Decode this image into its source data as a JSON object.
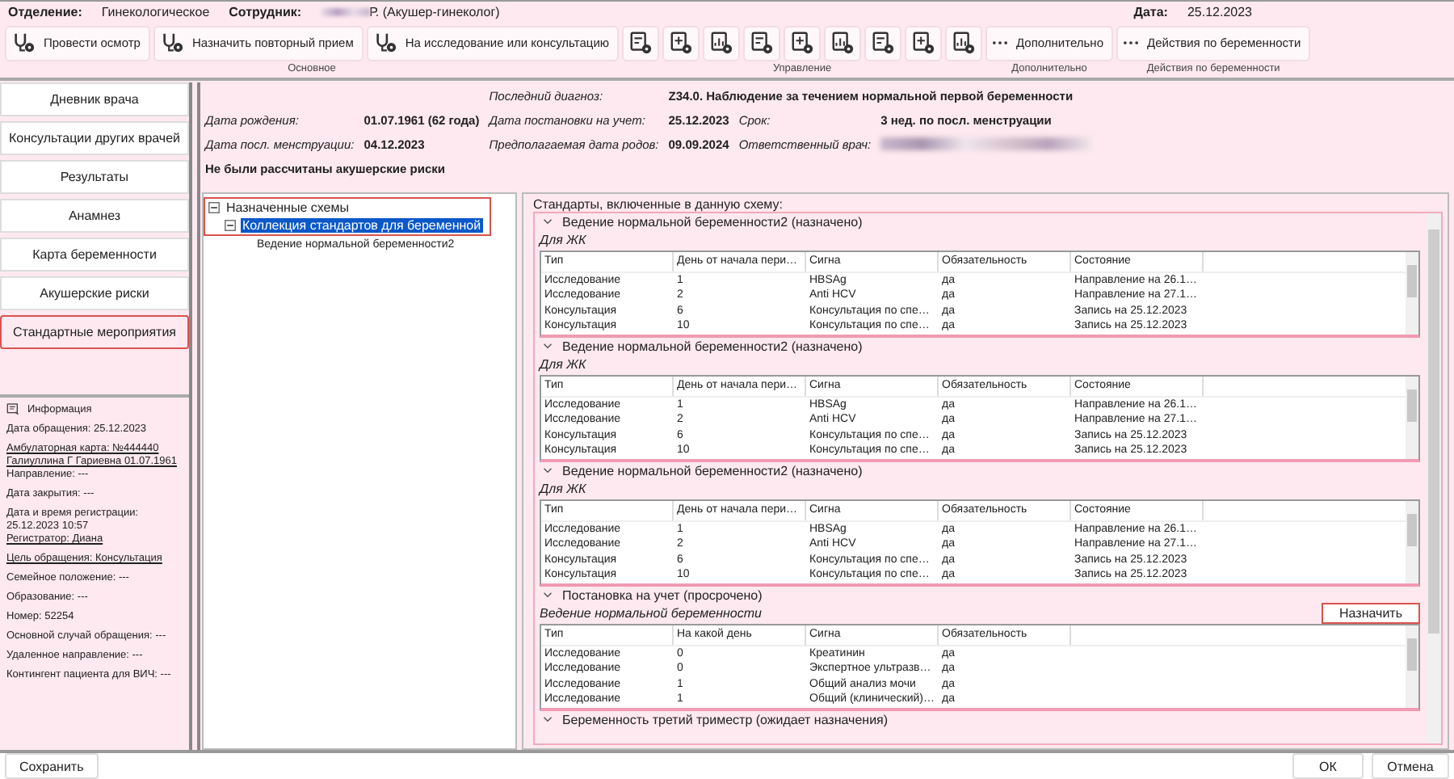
{
  "header": {
    "department_label": "Отделение:",
    "department": "Гинекологическое",
    "employee_label": "Сотрудник:",
    "employee": "Р. (Акушер-гинеколог)",
    "date_label": "Дата:",
    "date": "25.12.2023"
  },
  "toolbar": [
    {
      "label": "Основное",
      "buttons": [
        {
          "kind": "labeled",
          "label": "Провести осмотр"
        },
        {
          "kind": "labeled",
          "label": "Назначить повторный прием"
        },
        {
          "kind": "labeled",
          "label": "На исследование или консультацию"
        }
      ]
    },
    {
      "label": "Управление",
      "buttons": [
        {
          "kind": "icon"
        },
        {
          "kind": "icon"
        },
        {
          "kind": "icon"
        },
        {
          "kind": "icon"
        },
        {
          "kind": "icon"
        },
        {
          "kind": "icon"
        },
        {
          "kind": "icon"
        },
        {
          "kind": "icon"
        },
        {
          "kind": "icon"
        }
      ]
    },
    {
      "label": "Дополнительно",
      "buttons": [
        {
          "kind": "more",
          "label": "Дополнительно"
        }
      ]
    },
    {
      "label": "Действия по беременности",
      "buttons": [
        {
          "kind": "more",
          "label": "Действия по беременности"
        }
      ]
    }
  ],
  "sidebar": {
    "items": [
      {
        "label": "Дневник врача",
        "selected": false
      },
      {
        "label": "Консультации других врачей",
        "selected": false
      },
      {
        "label": "Результаты",
        "selected": false
      },
      {
        "label": "Анамнез",
        "selected": false
      },
      {
        "label": "Карта беременности",
        "selected": false
      },
      {
        "label": "Акушерские риски",
        "selected": false
      },
      {
        "label": "Стандартные мероприятия",
        "selected": true
      }
    ]
  },
  "info": {
    "title": "Информация",
    "paragraphs": [
      [
        {
          "text": "Дата обращения: 25.12.2023",
          "link": false
        }
      ],
      [
        {
          "text": "Амбулаторная карта: №444440",
          "link": true
        },
        {
          "text": "Галиуллина Г Гариевна 01.07.1961",
          "link": true
        },
        {
          "text": "Направление: ---",
          "link": false
        }
      ],
      [
        {
          "text": "Дата закрытия: ---",
          "link": false
        }
      ],
      [
        {
          "text": "Дата и время регистрации:",
          "link": false
        },
        {
          "text": "25.12.2023 10:57",
          "link": false
        },
        {
          "text": "Регистратор: Диана",
          "link": true
        }
      ],
      [
        {
          "text": "Цель обращения: Консультация",
          "link": true
        }
      ],
      [
        {
          "text": "Семейное положение: ---",
          "link": false
        }
      ],
      [
        {
          "text": "Образование: ---",
          "link": false
        }
      ],
      [
        {
          "text": "Номер: 52254",
          "link": false
        }
      ],
      [
        {
          "text": "Основной случай обращения: ---",
          "link": false
        }
      ],
      [
        {
          "text": "Удаленное направление: ---",
          "link": false
        }
      ],
      [
        {
          "text": "Контингент пациента для ВИЧ: ---",
          "link": false
        }
      ]
    ]
  },
  "patient": {
    "diagnosis_label": "Последний диагноз:",
    "diagnosis": "Z34.0. Наблюдение за течением нормальной первой беременности",
    "fields": [
      {
        "label": "Дата рождения:",
        "value": "01.07.1961 (62 года)"
      },
      {
        "label": "Дата постановки на учет:",
        "value": "25.12.2023"
      },
      {
        "label": "Срок:",
        "value": "3 нед.  по посл. менструации"
      },
      {
        "label": "Дата посл. менструации:",
        "value": "04.12.2023"
      },
      {
        "label": "Предполагаемая дата родов:",
        "value": "09.09.2024"
      },
      {
        "label": "Ответственный врач:",
        "kind": "blurred"
      }
    ],
    "warning": "Не были рассчитаны акушерские риски"
  },
  "tree": [
    {
      "label": "Назначенные схемы",
      "expanded": true,
      "selected": false,
      "highlighted": true,
      "children": [
        {
          "label": "Коллекция стандартов для беременной",
          "expanded": true,
          "selected": true,
          "highlighted": true,
          "children": [
            {
              "label": "Ведение нормальной беременности2",
              "selected": false,
              "highlighted": false
            }
          ]
        }
      ]
    }
  ],
  "standards": {
    "title": "Стандарты, включенные в данную схему:",
    "sections": [
      {
        "title": "Ведение нормальной беременности2 (назначено)",
        "subtitle": "Для ЖК",
        "columns": [
          "Тип",
          "День от начала пери…",
          "Сигна",
          "Обязательность",
          "Состояние"
        ],
        "rows": [
          [
            "Исследование",
            "1",
            "HBSAg",
            "да",
            "Направление на 26.1…"
          ],
          [
            "Исследование",
            "2",
            "Anti HCV",
            "да",
            "Направление на 27.1…"
          ],
          [
            "Консультация",
            "6",
            "Консультация по спе…",
            "да",
            "Запись на 25.12.2023"
          ],
          [
            "Консультация",
            "10",
            "Консультация по спе…",
            "да",
            "Запись на 25.12.2023"
          ]
        ]
      },
      {
        "title": "Ведение нормальной беременности2 (назначено)",
        "subtitle": "Для ЖК",
        "columns": [
          "Тип",
          "День от начала пери…",
          "Сигна",
          "Обязательность",
          "Состояние"
        ],
        "rows": [
          [
            "Исследование",
            "1",
            "HBSAg",
            "да",
            "Направление на 26.1…"
          ],
          [
            "Исследование",
            "2",
            "Anti HCV",
            "да",
            "Направление на 27.1…"
          ],
          [
            "Консультация",
            "6",
            "Консультация по спе…",
            "да",
            "Запись на 25.12.2023"
          ],
          [
            "Консультация",
            "10",
            "Консультация по спе…",
            "да",
            "Запись на 25.12.2023"
          ]
        ]
      },
      {
        "title": "Ведение нормальной беременности2 (назначено)",
        "subtitle": "Для ЖК",
        "columns": [
          "Тип",
          "День от начала пери…",
          "Сигна",
          "Обязательность",
          "Состояние"
        ],
        "rows": [
          [
            "Исследование",
            "1",
            "HBSAg",
            "да",
            "Направление на 26.1…"
          ],
          [
            "Исследование",
            "2",
            "Anti HCV",
            "да",
            "Направление на 27.1…"
          ],
          [
            "Консультация",
            "6",
            "Консультация по спе…",
            "да",
            "Запись на 25.12.2023"
          ],
          [
            "Консультация",
            "10",
            "Консультация по спе…",
            "да",
            "Запись на 25.12.2023"
          ]
        ]
      },
      {
        "title": "Постановка на учет (просрочено)",
        "subtitle": "Ведение нормальной беременности",
        "action": {
          "label": "Назначить",
          "highlighted": true
        },
        "columns": [
          "Тип",
          "На какой день",
          "Сигна",
          "Обязательность"
        ],
        "rows": [
          [
            "Исследование",
            "0",
            "Креатинин",
            "да"
          ],
          [
            "Исследование",
            "0",
            "Экспертное ультразв…",
            "да"
          ],
          [
            "Исследование",
            "1",
            "Общий анализ мочи",
            "да"
          ],
          [
            "Исследование",
            "1",
            "Общий (клинический)…",
            "да"
          ]
        ]
      },
      {
        "title": "Беременность третий триместр (ожидает назначения)"
      }
    ]
  },
  "footer": {
    "save": "Сохранить",
    "ok": "ОК",
    "cancel": "Отмена"
  }
}
